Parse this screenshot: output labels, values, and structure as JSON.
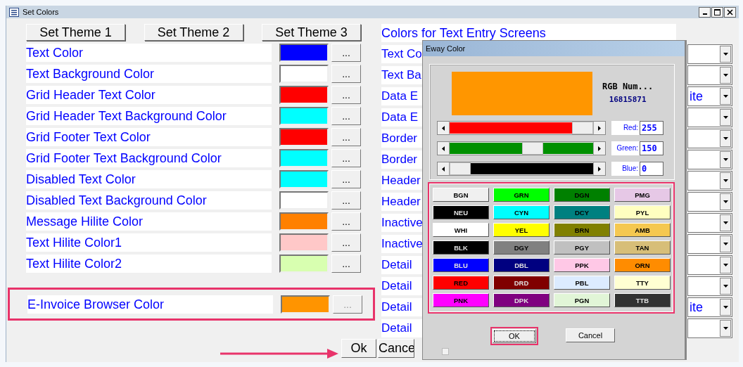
{
  "window": {
    "title": "Set Colors"
  },
  "theme_buttons": [
    "Set Theme 1",
    "Set Theme 2",
    "Set Theme 3"
  ],
  "color_rows": [
    {
      "label": "Text Color",
      "color": "#0000ff",
      "button": "...",
      "disabled": false
    },
    {
      "label": "Text Background Color",
      "color": "#ffffff",
      "button": "...",
      "disabled": false
    },
    {
      "label": "Grid Header Text Color",
      "color": "#ff0000",
      "button": "...",
      "disabled": false
    },
    {
      "label": "Grid Header Text Background Color",
      "color": "#00ffff",
      "button": "...",
      "disabled": false
    },
    {
      "label": "Grid Footer Text Color",
      "color": "#ff0000",
      "button": "...",
      "disabled": false
    },
    {
      "label": "Grid Footer Text Background Color",
      "color": "#00ffff",
      "button": "...",
      "disabled": false
    },
    {
      "label": "Disabled Text Color",
      "color": "#00ffff",
      "button": "...",
      "disabled": false
    },
    {
      "label": "Disabled Text Background Color",
      "color": "#ffffff",
      "button": "...",
      "disabled": false
    },
    {
      "label": "Message Hilite Color",
      "color": "#ff8000",
      "button": "...",
      "disabled": false
    },
    {
      "label": "Text Hilite Color1",
      "color": "#ffc8c8",
      "button": "...",
      "disabled": false
    },
    {
      "label": "Text Hilite Color2",
      "color": "#d8ffb0",
      "button": "...",
      "disabled": false
    }
  ],
  "invoice_row": {
    "label": "E-Invoice Browser Color",
    "color": "#ff9400",
    "button": "...",
    "disabled": true
  },
  "footer_buttons": [
    "Ok",
    "Cance"
  ],
  "entry_screens": {
    "title": "Colors for Text Entry Screens",
    "rows": [
      {
        "label": "Text Co"
      },
      {
        "label": "Text Ba"
      },
      {
        "label": "Data E",
        "value": "ite"
      },
      {
        "label": "Data E"
      },
      {
        "label": "Border"
      },
      {
        "label": "Border"
      },
      {
        "label": "Header"
      },
      {
        "label": "Header"
      },
      {
        "label": "Inactive"
      },
      {
        "label": "Inactive"
      },
      {
        "label": "Detail"
      },
      {
        "label": "Detail"
      },
      {
        "label": "Detail",
        "value": "ite"
      },
      {
        "label": "Detail"
      }
    ]
  },
  "dialog": {
    "title": "Eway Color",
    "rgb_label": "RGB Num...",
    "rgb_value": "16815871",
    "sliders": [
      {
        "label": "Red:",
        "value": "255",
        "level": 1,
        "color": "#ff0000"
      },
      {
        "label": "Green:",
        "value": "150",
        "level": 0.59,
        "color": "#009000"
      },
      {
        "label": "Blue:",
        "value": "0",
        "level": 0,
        "color": "#000000"
      }
    ],
    "palette": [
      {
        "label": "BGN",
        "color": "#f0f0f0"
      },
      {
        "label": "GRN",
        "color": "#00ff00"
      },
      {
        "label": "DGN",
        "color": "#008000"
      },
      {
        "label": "PMG",
        "color": "#e6c8e6"
      },
      {
        "label": "NEU",
        "color": "#000000"
      },
      {
        "label": "CYN",
        "color": "#00ffff"
      },
      {
        "label": "DCY",
        "color": "#008080"
      },
      {
        "label": "PYL",
        "color": "#ffffc0"
      },
      {
        "label": "WHI",
        "color": "#ffffff"
      },
      {
        "label": "YEL",
        "color": "#ffff00"
      },
      {
        "label": "BRN",
        "color": "#808000"
      },
      {
        "label": "AMB",
        "color": "#f5c850"
      },
      {
        "label": "BLK",
        "color": "#000000"
      },
      {
        "label": "DGY",
        "color": "#808080"
      },
      {
        "label": "PGY",
        "color": "#c0c0c0"
      },
      {
        "label": "TAN",
        "color": "#d7be78"
      },
      {
        "label": "BLU",
        "color": "#0000ff"
      },
      {
        "label": "DBL",
        "color": "#000080"
      },
      {
        "label": "PPK",
        "color": "#ffc8e6"
      },
      {
        "label": "ORN",
        "color": "#ff8c00"
      },
      {
        "label": "RED",
        "color": "#ff0000"
      },
      {
        "label": "DRD",
        "color": "#800000"
      },
      {
        "label": "PBL",
        "color": "#dcebff"
      },
      {
        "label": "TTY",
        "color": "#ffffd2"
      },
      {
        "label": "PNK",
        "color": "#ff00ff"
      },
      {
        "label": "DPK",
        "color": "#800080"
      },
      {
        "label": "PGN",
        "color": "#e1f5d7"
      },
      {
        "label": "TTB",
        "color": "#323232"
      }
    ],
    "buttons": [
      {
        "label": "OK",
        "default": true
      },
      {
        "label": "Cancel",
        "default": false
      }
    ]
  }
}
